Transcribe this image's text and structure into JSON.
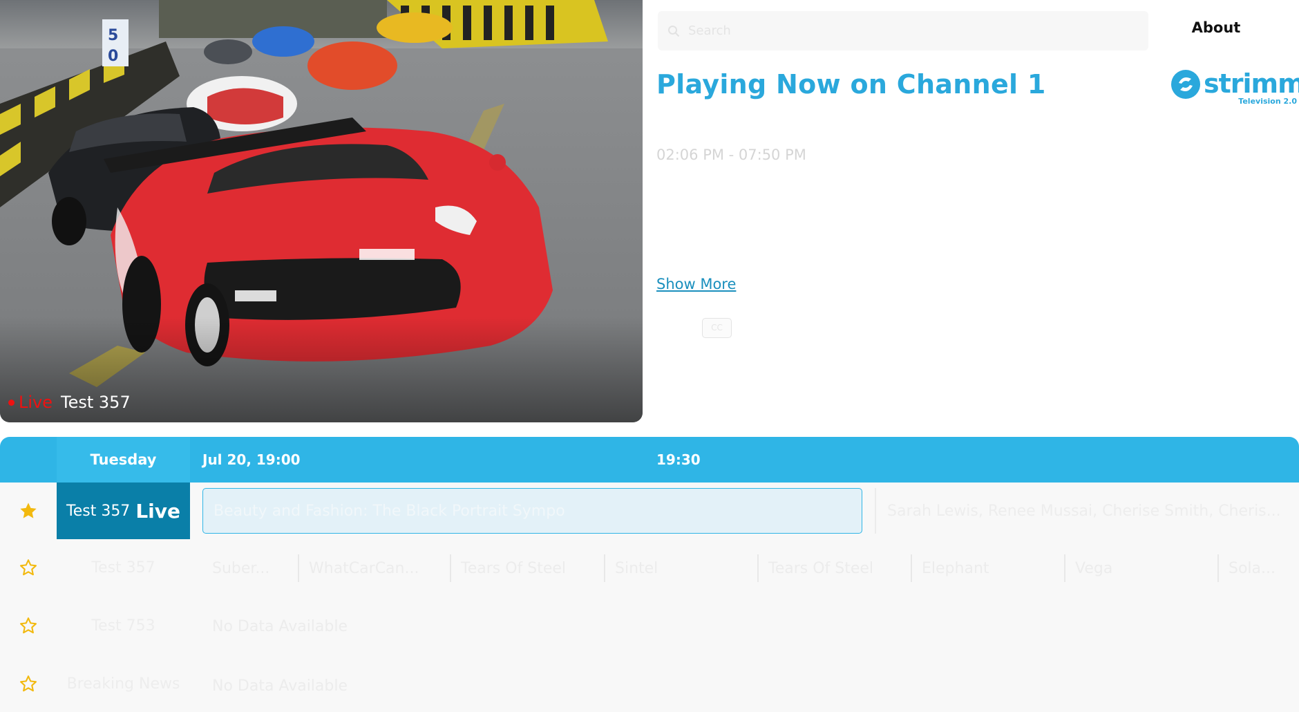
{
  "player": {
    "live_label": "Live",
    "channel_name": "Test 357"
  },
  "search": {
    "placeholder": "Search"
  },
  "header": {
    "about_label": "About"
  },
  "logo": {
    "wordmark": "strimm",
    "tagline": "Television 2.0"
  },
  "now_playing": {
    "title": "Playing Now on Channel 1",
    "time_range": "02:06 PM - 07:50 PM",
    "show_more_label": "Show More",
    "cc_label": "CC"
  },
  "guide": {
    "day": "Tuesday",
    "time_slots": [
      "Jul 20, 19:00",
      "19:30"
    ],
    "channels": [
      {
        "name": "Test 357",
        "live_label": "Live",
        "favorite": true,
        "programs": [
          "Beauty and Fashion: The Black Portrait Sympo",
          "Sarah Lewis, Renee Mussai, Cherise Smith, Cheris..."
        ]
      },
      {
        "name": "Test 357",
        "favorite": false,
        "programs": [
          "Suber...",
          "WhatCarCan...",
          "Tears Of Steel",
          "Sintel",
          "Tears Of Steel",
          "Elephant",
          "Vega",
          "Sola..."
        ]
      },
      {
        "name": "Test 753",
        "favorite": false,
        "no_data": "No Data Available"
      },
      {
        "name": "Breaking News",
        "favorite": false,
        "no_data": "No Data Available"
      }
    ]
  },
  "colors": {
    "accent": "#2fb5e6",
    "active_channel": "#0a7fa8",
    "title_blue": "#2aa8dc",
    "live_red": "#ee1111",
    "star": "#f2b90f"
  }
}
